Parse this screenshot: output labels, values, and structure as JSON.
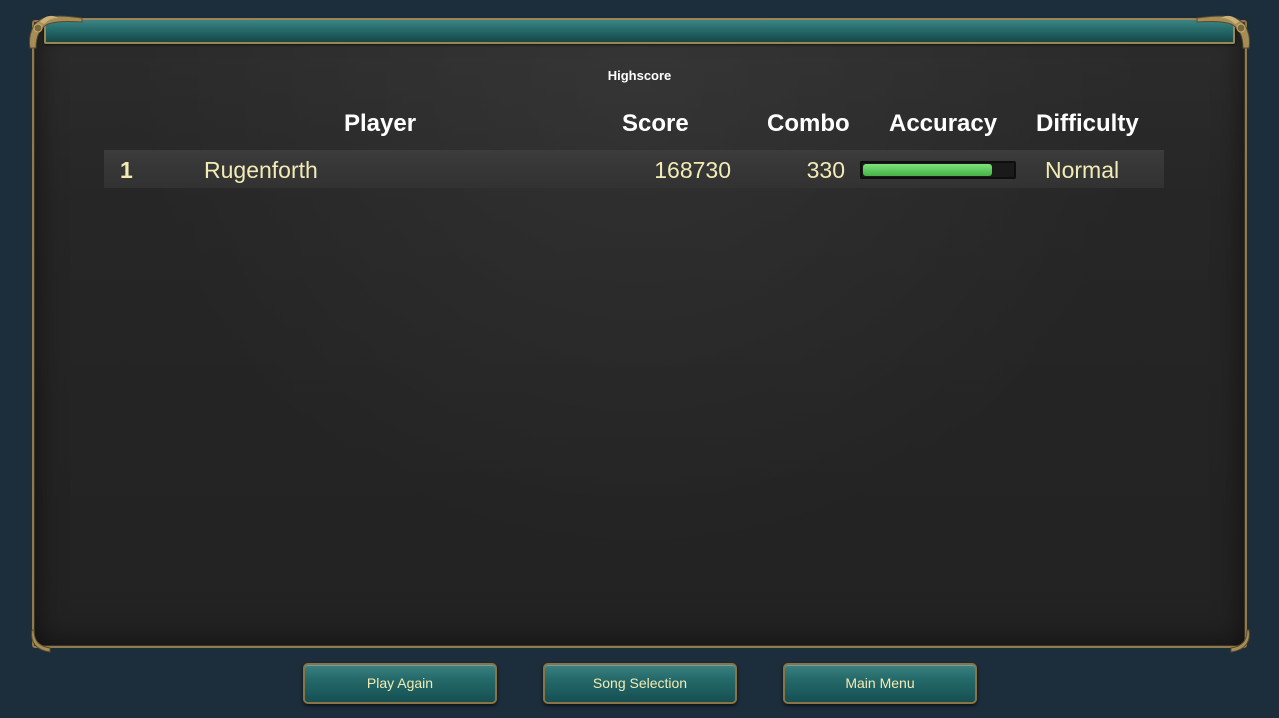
{
  "panel": {
    "title": "Highscore"
  },
  "table": {
    "headers": {
      "player": "Player",
      "score": "Score",
      "combo": "Combo",
      "accuracy": "Accuracy",
      "difficulty": "Difficulty"
    },
    "rows": [
      {
        "rank": "1",
        "player": "Rugenforth",
        "score": "168730",
        "combo": "330",
        "accuracy_fraction": 0.86,
        "difficulty": "Normal"
      }
    ]
  },
  "buttons": {
    "play_again": "Play Again",
    "song_selection": "Song Selection",
    "main_menu": "Main Menu"
  },
  "colors": {
    "background": "#1c2d3b",
    "panel": "#262626",
    "frame_gold": "#8f7a4b",
    "teal_bar": "#2a6f6f",
    "row_text": "#f2ebb6",
    "header_text": "#ffffff",
    "accuracy_fill": "#5cc85c"
  }
}
